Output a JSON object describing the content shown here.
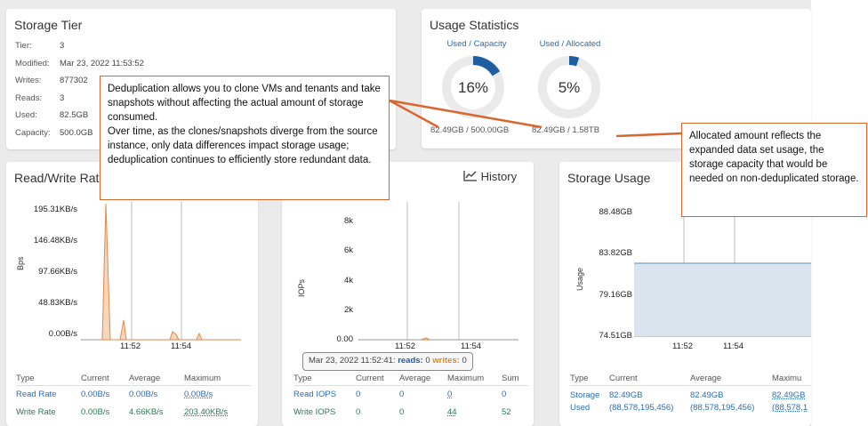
{
  "storage_tier": {
    "title": "Storage Tier",
    "rows": [
      {
        "key": "Tier:",
        "value": "3"
      },
      {
        "key": "Modified:",
        "value": "Mar 23, 2022 11:53:52"
      },
      {
        "key": "Writes:",
        "value": "877302"
      },
      {
        "key": "Reads:",
        "value": "3"
      },
      {
        "key": "Used:",
        "value": "82.5GB"
      },
      {
        "key": "Capacity:",
        "value": "500.0GB"
      }
    ]
  },
  "usage_statistics": {
    "title": "Usage Statistics",
    "gauges": [
      {
        "label": "Used / Capacity",
        "percent_text": "16%",
        "fraction": 0.165,
        "footer": "82.49GB / 500.00GB"
      },
      {
        "label": "Used / Allocated",
        "percent_text": "5%",
        "fraction": 0.052,
        "footer": "82.49GB / 1.58TB"
      }
    ],
    "accent": "#1f5fa0",
    "track": "#eaeaea"
  },
  "read_write_rate": {
    "title": "Read/Write Rat",
    "ylabel": "Bps",
    "y_ticks": [
      "195.31KB/s",
      "146.48KB/s",
      "97.66KB/s",
      "48.83KB/s",
      "0.00B/s"
    ],
    "x_ticks": [
      "11:52",
      "11:54"
    ],
    "table": {
      "headers": [
        "Type",
        "Current",
        "Average",
        "Maximum"
      ],
      "rows": [
        [
          "Read Rate",
          "0.00B/s",
          "0.00B/s",
          "0.00B/s"
        ],
        [
          "Write Rate",
          "0.00B/s",
          "4.66KB/s",
          "203.40KB/s"
        ]
      ]
    }
  },
  "iops": {
    "history_label": "History",
    "ylabel": "IOPs",
    "y_ticks": [
      "8k",
      "6k",
      "4k",
      "2k",
      "0.00"
    ],
    "x_ticks": [
      "11:52",
      "11:54"
    ],
    "tooltip": {
      "time": "Mar 23, 2022 11:52:41:",
      "reads_label": "reads:",
      "reads": "0",
      "writes_label": "writes:",
      "writes": "0"
    },
    "table": {
      "headers": [
        "Type",
        "Current",
        "Average",
        "Maximum",
        "Sum"
      ],
      "rows": [
        [
          "Read IOPS",
          "0",
          "0",
          "0",
          "0"
        ],
        [
          "Write IOPS",
          "0",
          "0",
          "44",
          "52"
        ]
      ]
    }
  },
  "storage_usage": {
    "title": "Storage Usage",
    "ylabel": "Usage",
    "y_ticks": [
      "88.48GB",
      "83.82GB",
      "79.16GB",
      "74.51GB"
    ],
    "x_ticks": [
      "11:52",
      "11:54"
    ],
    "table": {
      "headers": [
        "Type",
        "Current",
        "Average",
        "Maximu"
      ],
      "row_type_1": "Storage",
      "row_type_2": "Used",
      "current_1": "82.49GB",
      "current_2": "(88,578,195,456)",
      "average_1": "82.49GB",
      "average_2": "(88,578,195,456)",
      "max_1": "82.49GB",
      "max_2": "(88,578,1"
    }
  },
  "callouts": {
    "dedup": "Deduplication allows you to clone VMs and tenants and take snapshots without affecting the actual amount of storage consumed.\nOver time, as the clones/snapshots diverge from the source instance, only data differences impact storage usage; deduplication continues to efficiently store redundant data.",
    "allocated": "Allocated amount reflects the expanded data set usage, the storage capacity that would be needed on non-deduplicated storage."
  }
}
